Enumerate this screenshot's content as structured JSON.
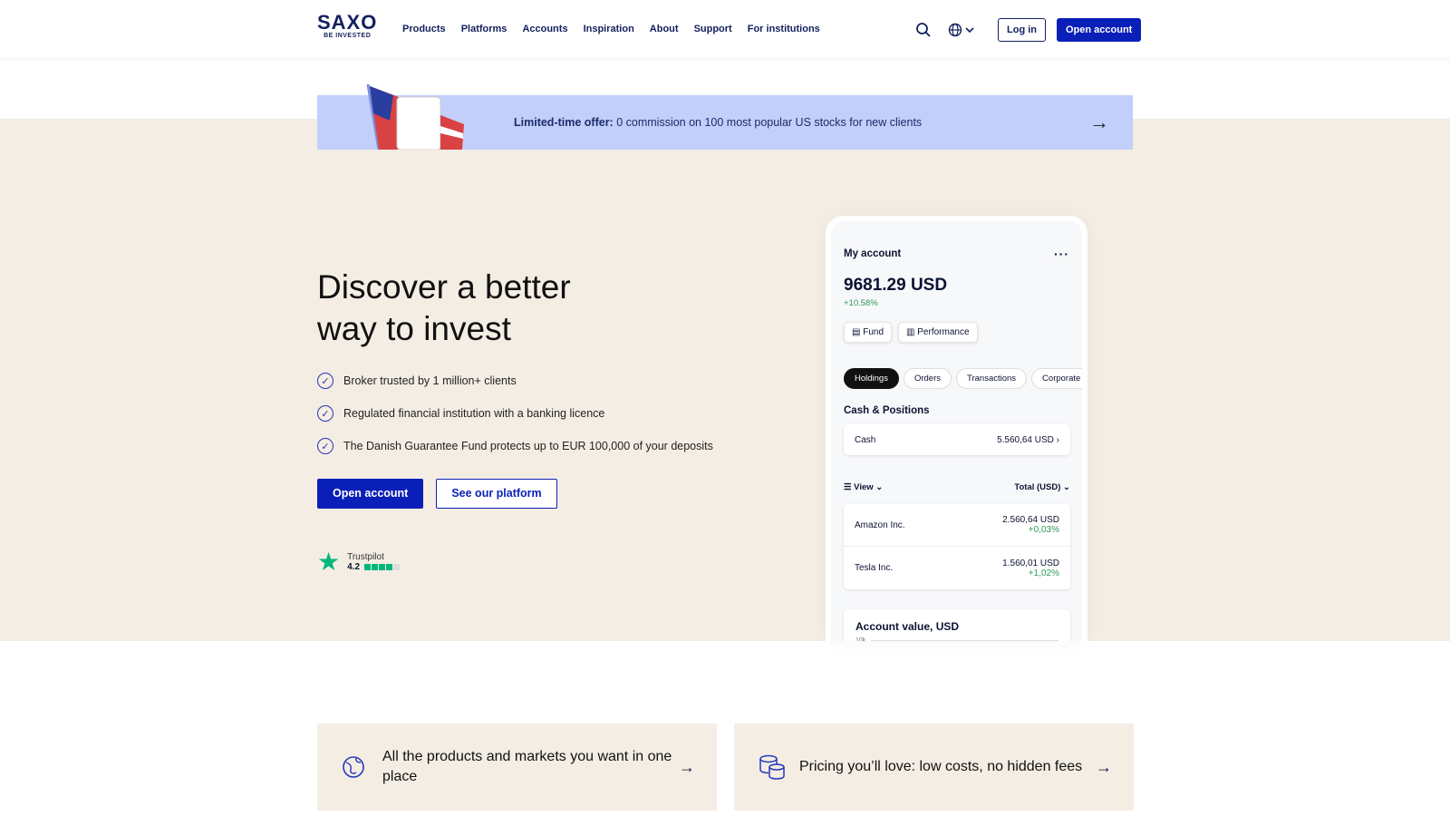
{
  "header": {
    "logo": "SAXO",
    "tagline": "BE INVESTED",
    "nav": [
      "Products",
      "Platforms",
      "Accounts",
      "Inspiration",
      "About",
      "Support",
      "For institutions"
    ],
    "login": "Log in",
    "open_account": "Open account"
  },
  "banner": {
    "bold": "Limited-time offer:",
    "text": "0 commission on 100 most popular US stocks for new clients"
  },
  "hero": {
    "title_line1": "Discover a better",
    "title_line2": "way to invest",
    "checks": [
      "Broker trusted by 1 million+ clients",
      "Regulated financial institution with a banking licence",
      "The Danish Guarantee Fund protects up to EUR 100,000 of your deposits"
    ],
    "primary": "Open account",
    "secondary": "See our platform",
    "trustpilot": {
      "label": "Trustpilot",
      "score": "4.2",
      "stars": 4.2
    }
  },
  "phone": {
    "title": "My account",
    "balance": "9681.29 USD",
    "change": "+10.58%",
    "fund": "Fund",
    "performance": "Performance",
    "tabs": [
      "Holdings",
      "Orders",
      "Transactions",
      "Corporate"
    ],
    "section": "Cash & Positions",
    "cash_label": "Cash",
    "cash_value": "5.560,64 USD",
    "view": "View",
    "total": "Total (USD)",
    "holdings": [
      {
        "name": "Amazon Inc.",
        "value": "2.560,64 USD",
        "change": "+0,03%"
      },
      {
        "name": "Tesla Inc.",
        "value": "1.560,01 USD",
        "change": "+1,02%"
      }
    ],
    "chart_title": "Account value, USD",
    "chart_tick": "10k"
  },
  "features": [
    {
      "text": "All the products and markets you want in one place"
    },
    {
      "text": "Pricing you’ll love: low costs, no hidden fees"
    }
  ],
  "colors": {
    "brand": "#0a1fb8",
    "navy": "#12205e",
    "beige": "#f4ede4",
    "banner": "#c2cffa",
    "positive": "#2f9a5a"
  }
}
